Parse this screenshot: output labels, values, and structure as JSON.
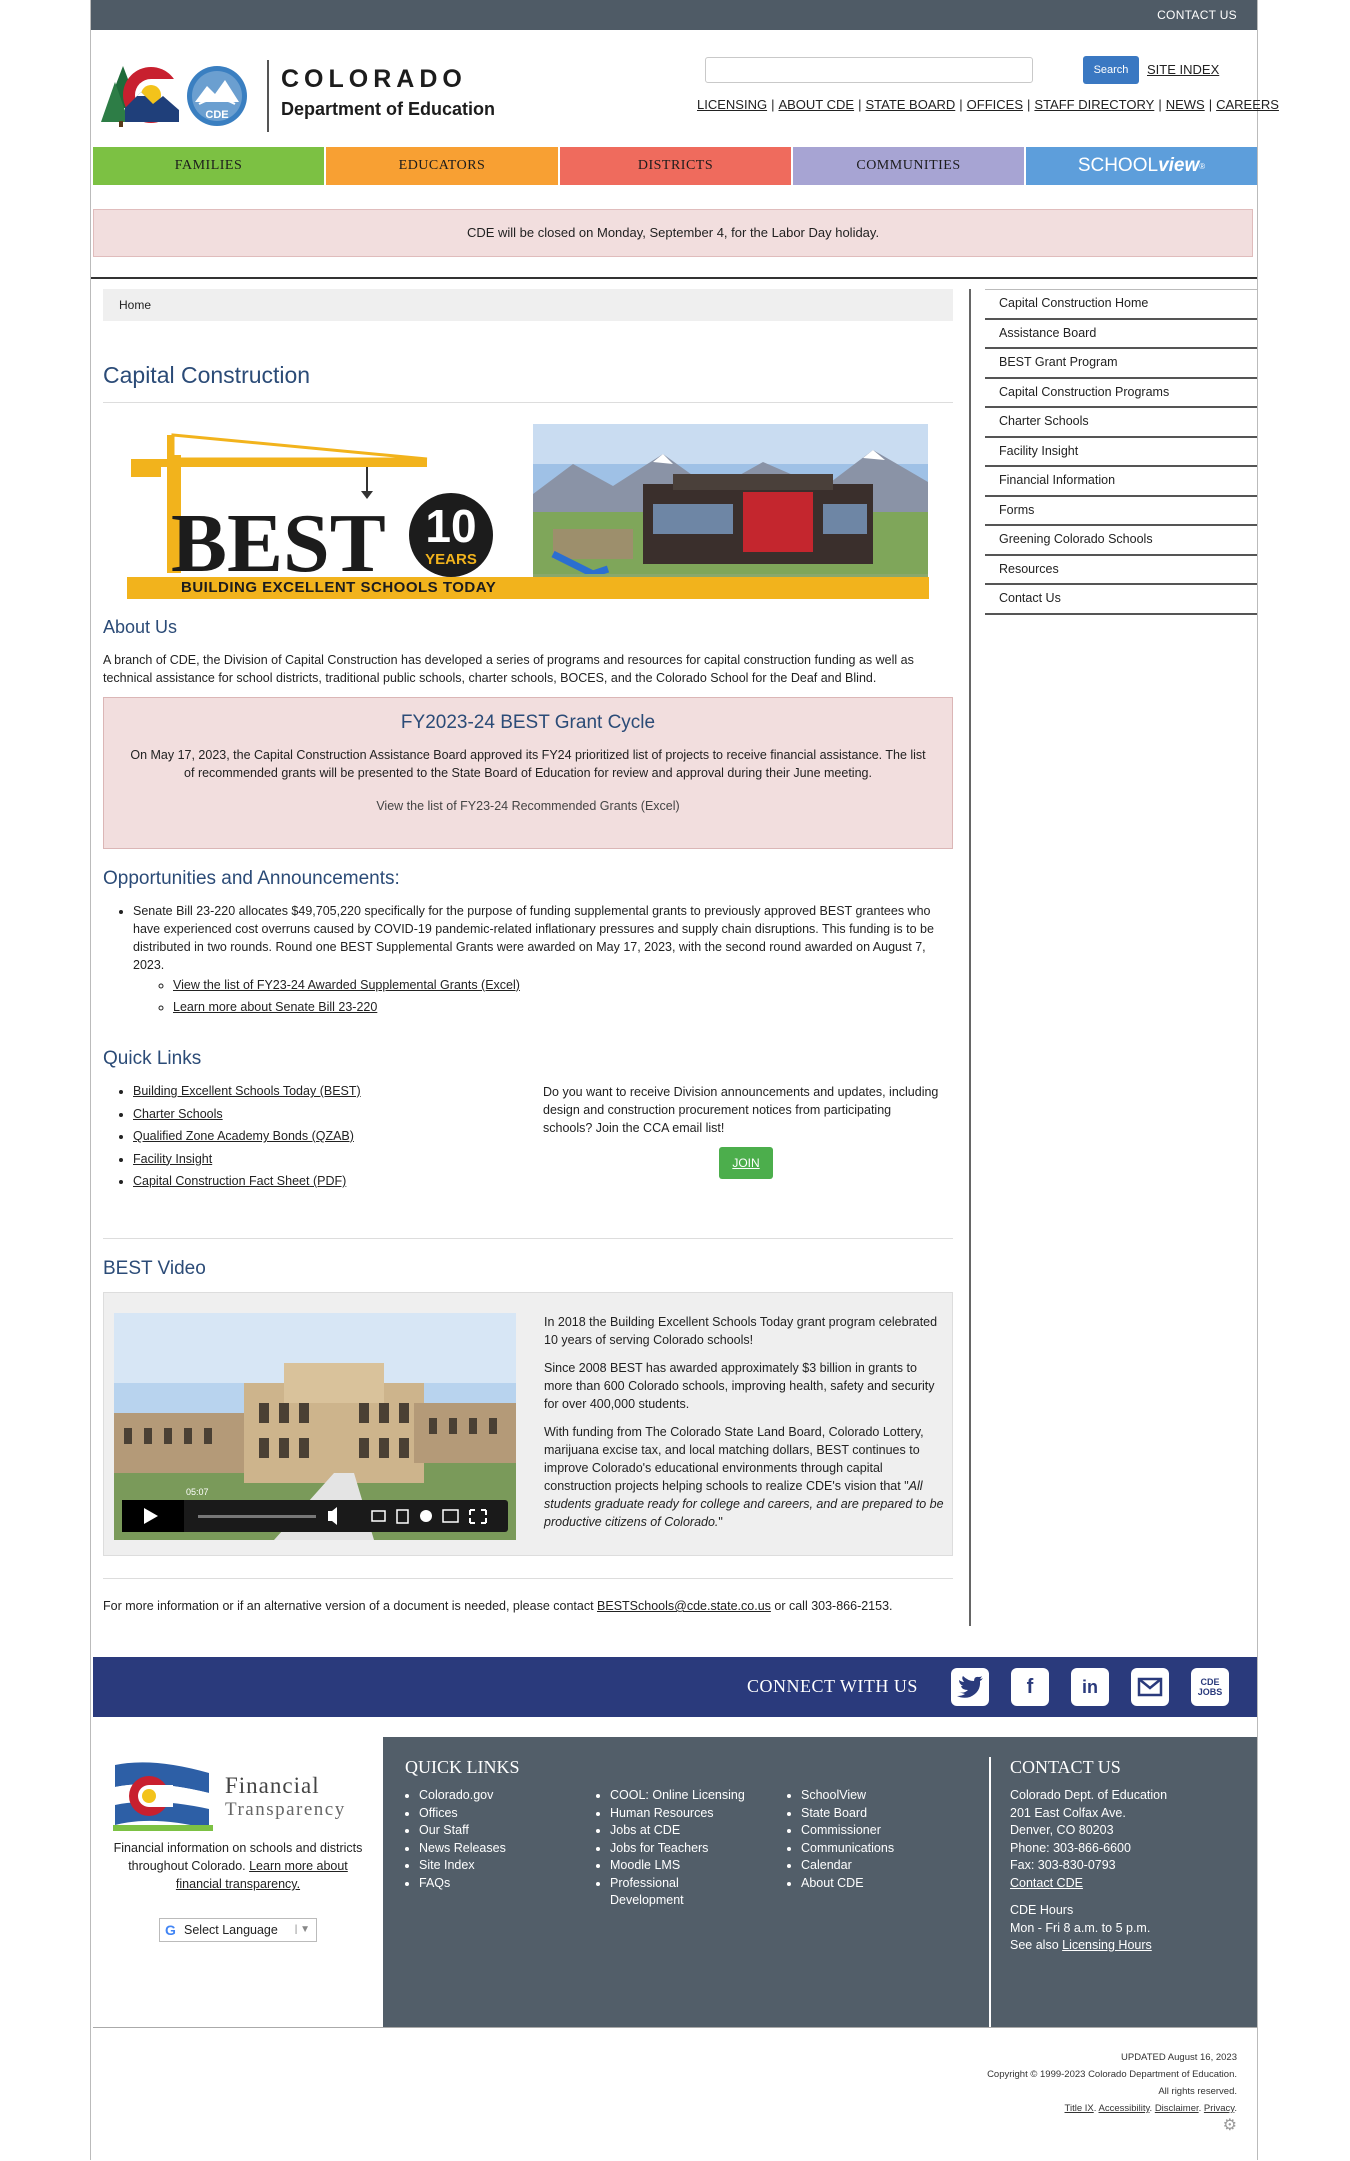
{
  "topbar": {
    "contact": "CONTACT US"
  },
  "header": {
    "logo_title_1": "COLORADO",
    "logo_title_2": "Department of Education",
    "logo_cde": "CDE",
    "search_placeholder": "",
    "search_button": "Search",
    "site_index": "SITE INDEX",
    "util_links": [
      "LICENSING",
      "ABOUT CDE",
      "STATE BOARD",
      "OFFICES",
      "STAFF DIRECTORY",
      "NEWS",
      "CAREERS"
    ]
  },
  "nav": {
    "items": [
      {
        "label": "FAMILIES",
        "color": "#7cc143"
      },
      {
        "label": "EDUCATORS",
        "color": "#f8a033"
      },
      {
        "label": "DISTRICTS",
        "color": "#ef6b5d"
      },
      {
        "label": "COMMUNITIES",
        "color": "#a7a4d3"
      }
    ],
    "schoolview_prefix": "SCHOOL",
    "schoolview_suffix": "view",
    "schoolview_color": "#5d9edb"
  },
  "alert": "CDE will be closed on Monday, September 4, for the Labor Day holiday.",
  "breadcrumb": "Home",
  "page_title": "Capital Construction",
  "banner": {
    "best_word": "BEST",
    "ten": "10",
    "years": "YEARS",
    "tagline": "BUILDING EXCELLENT SCHOOLS TODAY"
  },
  "about": {
    "heading": "About Us",
    "text": "A branch of CDE, the Division of Capital Construction has developed a series of programs and resources for capital construction funding as well as technical assistance for school districts, traditional public schools, charter schools, BOCES, and the Colorado School for the Deaf and Blind."
  },
  "grant": {
    "title": "FY2023-24 BEST Grant Cycle",
    "body": "On May 17, 2023, the Capital Construction Assistance Board approved its FY24 prioritized list of projects to receive financial assistance. The list of recommended grants will be presented to the State Board of Education for review and approval during their June meeting.",
    "link": "View the list of FY23-24 Recommended Grants (Excel)"
  },
  "opportunities": {
    "heading": "Opportunities and Announcements:",
    "item": "Senate Bill 23-220 allocates $49,705,220 specifically for the purpose of funding supplemental grants to previously approved BEST grantees who have experienced cost overruns caused by COVID-19 pandemic-related inflationary pressures and supply chain disruptions. This funding is to be distributed in two rounds. Round one BEST Supplemental Grants were awarded on May 17, 2023, with the second round awarded on August 7, 2023.",
    "sub_links": [
      "View the list of FY23-24 Awarded Supplemental Grants (Excel)",
      "Learn more about Senate Bill 23-220"
    ]
  },
  "quick_links": {
    "heading": "Quick Links",
    "items": [
      "Building Excellent Schools Today (BEST)",
      "Charter Schools",
      "Qualified Zone Academy Bonds (QZAB)",
      "Facility Insight",
      "Capital Construction Fact Sheet (PDF)"
    ],
    "join_text": "Do you want to receive Division announcements and updates, including design and construction procurement notices from participating schools?  Join the CCA email list!",
    "join_button": "JOIN"
  },
  "video": {
    "heading": "BEST Video",
    "duration": "05:07",
    "p1": "In 2018 the Building Excellent Schools Today grant program celebrated 10 years of serving Colorado schools!",
    "p2": "Since 2008 BEST has awarded approximately $3 billion in grants to more than 600 Colorado schools, improving health, safety and security for over 400,000 students.",
    "p3": "With funding from The Colorado State Land Board, Colorado Lottery, marijuana excise tax, and local matching dollars, BEST continues to improve Colorado's educational environments through capital construction projects helping schools to realize CDE's vision that \"",
    "p3_italic": "All students graduate ready for college and careers, and are prepared to be productive citizens of Colorado.",
    "p3_end": "\""
  },
  "contact_line": {
    "pre": "For more information or if an alternative version of a document is needed, please contact ",
    "email": "BESTSchools@cde.state.co.us",
    "post": " or call 303-866-2153."
  },
  "sidebar": [
    "Capital Construction Home",
    "Assistance Board",
    "BEST Grant Program",
    "Capital Construction Programs",
    "Charter Schools",
    "Facility Insight",
    "Financial Information",
    "Forms",
    "Greening Colorado Schools",
    "Resources",
    "Contact Us"
  ],
  "connect": {
    "label": "CONNECT WITH US",
    "cde_jobs_1": "CDE",
    "cde_jobs_2": "JOBS"
  },
  "footer": {
    "fin_title_1": "Financial",
    "fin_title_2": "Transparency",
    "fin_text": "Financial information on schools and districts throughout Colorado. ",
    "fin_link": "Learn more about financial transparency.",
    "language": "Select Language",
    "quick_links_heading": "QUICK LINKS",
    "col1": [
      "Colorado.gov",
      "Offices",
      "Our Staff",
      "News Releases",
      "Site Index",
      "FAQs"
    ],
    "col2": [
      "COOL: Online Licensing",
      "Human Resources",
      "Jobs at CDE",
      "Jobs for Teachers",
      "Moodle LMS",
      "Professional Development"
    ],
    "col3": [
      "SchoolView",
      "State Board",
      "Commissioner",
      "Communications",
      "Calendar",
      "About CDE"
    ],
    "contact_heading": "CONTACT US",
    "contact_lines": [
      "Colorado Dept. of Education",
      "201 East Colfax Ave.",
      "Denver, CO 80203",
      "Phone: 303-866-6600",
      "Fax: 303-830-0793"
    ],
    "contact_link": "Contact CDE",
    "hours_heading": "CDE Hours",
    "hours": "Mon - Fri 8 a.m. to 5 p.m.",
    "hours_also": "See also ",
    "hours_link": "Licensing Hours"
  },
  "bottom": {
    "updated": "UPDATED August 16, 2023",
    "copyright": "Copyright © 1999-2023 Colorado Department of Education.",
    "rights": "All rights reserved.",
    "links": [
      "Title IX",
      "Accessibility",
      "Disclaimer",
      "Privacy"
    ]
  }
}
